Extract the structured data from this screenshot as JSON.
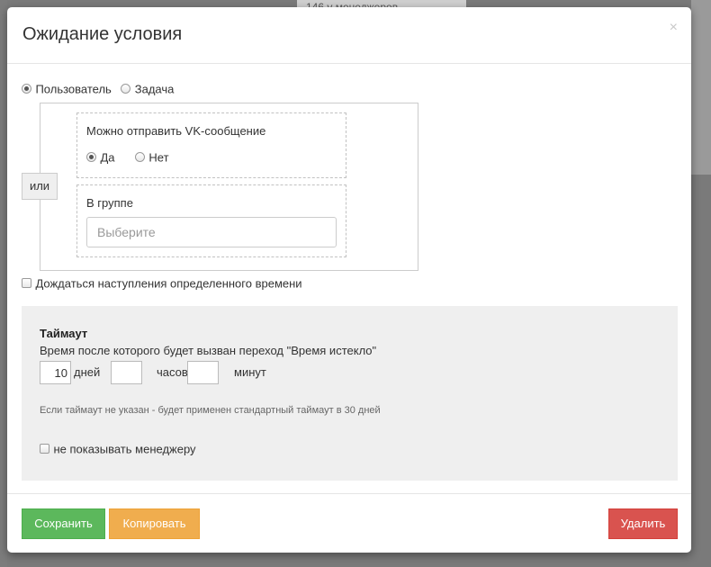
{
  "background": {
    "card_text": "146 у менеджеров"
  },
  "modal": {
    "title": "Ожидание условия",
    "close_label": "×"
  },
  "target": {
    "options": [
      {
        "label": "Пользователь",
        "selected": true
      },
      {
        "label": "Задача",
        "selected": false
      }
    ]
  },
  "conditions": {
    "or_label": "или",
    "vk": {
      "title": "Можно отправить VK-сообщение",
      "options": [
        {
          "label": "Да",
          "selected": true
        },
        {
          "label": "Нет",
          "selected": false
        }
      ]
    },
    "group": {
      "title": "В группе",
      "placeholder": "Выберите"
    }
  },
  "wait_time": {
    "label": "Дождаться наступления определенного времени",
    "checked": false
  },
  "timeout": {
    "title": "Таймаут",
    "description": "Время после которого будет вызван переход \"Время истекло\"",
    "days_value": "10",
    "days_label": "дней",
    "hours_value": "",
    "hours_label": "часов",
    "minutes_value": "",
    "minutes_label": "минут",
    "note": "Если таймаут не указан - будет применен стандартный таймаут в 30 дней",
    "hide_label": "не показывать менеджеру",
    "hide_checked": false
  },
  "footer": {
    "save_label": "Сохранить",
    "copy_label": "Копировать",
    "delete_label": "Удалить"
  },
  "colors": {
    "save": "#5cb85c",
    "copy": "#f0ad4e",
    "delete": "#d9534f",
    "timeout_bg": "#efefef"
  }
}
